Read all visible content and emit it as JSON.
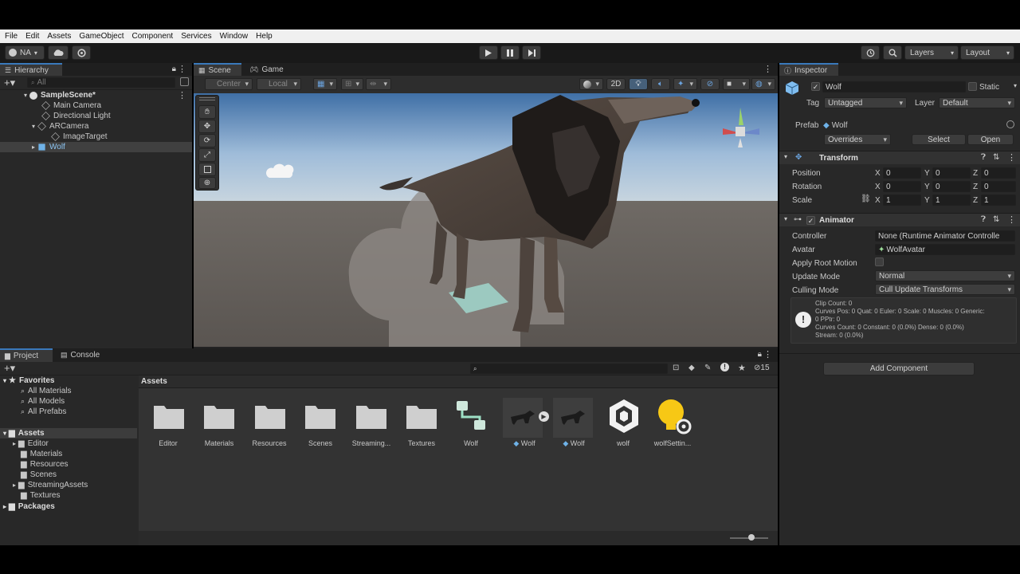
{
  "menu": [
    "File",
    "Edit",
    "Assets",
    "GameObject",
    "Component",
    "Services",
    "Window",
    "Help"
  ],
  "toolbar": {
    "account": "NA",
    "layers": "Layers",
    "layout": "Layout"
  },
  "hierarchy": {
    "tab": "Hierarchy",
    "search_placeholder": "All",
    "items": [
      {
        "label": "SampleScene*",
        "depth": 0,
        "bold": true
      },
      {
        "label": "Main Camera",
        "depth": 1
      },
      {
        "label": "Directional Light",
        "depth": 1
      },
      {
        "label": "ARCamera",
        "depth": 1
      },
      {
        "label": "ImageTarget",
        "depth": 2
      },
      {
        "label": "Wolf",
        "depth": 1,
        "selected": true
      }
    ]
  },
  "scene": {
    "tabs": [
      "Scene",
      "Game"
    ],
    "pivot": "Center",
    "space": "Local",
    "mode_2d": "2D"
  },
  "project": {
    "tabs": [
      "Project",
      "Console"
    ],
    "hidden_count": "15",
    "favorites_label": "Favorites",
    "favorites": [
      "All Materials",
      "All Models",
      "All Prefabs"
    ],
    "assets_root": "Assets",
    "asset_folders": [
      "Editor",
      "Materials",
      "Resources",
      "Scenes",
      "StreamingAssets",
      "Textures"
    ],
    "packages": "Packages",
    "breadcrumb": "Assets",
    "grid": [
      {
        "label": "Editor",
        "kind": "folder"
      },
      {
        "label": "Materials",
        "kind": "folder"
      },
      {
        "label": "Resources",
        "kind": "folder"
      },
      {
        "label": "Scenes",
        "kind": "folder"
      },
      {
        "label": "Streaming...",
        "kind": "folder"
      },
      {
        "label": "Textures",
        "kind": "folder"
      },
      {
        "label": "Wolf",
        "kind": "animator"
      },
      {
        "label": "Wolf",
        "kind": "model"
      },
      {
        "label": "Wolf",
        "kind": "prefab"
      },
      {
        "label": "wolf",
        "kind": "unity"
      },
      {
        "label": "wolfSettin...",
        "kind": "settings"
      }
    ]
  },
  "inspector": {
    "tab": "Inspector",
    "name": "Wolf",
    "static_label": "Static",
    "tag_label": "Tag",
    "tag_value": "Untagged",
    "layer_label": "Layer",
    "layer_value": "Default",
    "prefab_label": "Prefab",
    "prefab_value": "Wolf",
    "overrides": "Overrides",
    "select": "Select",
    "open": "Open",
    "transform": {
      "title": "Transform",
      "position_label": "Position",
      "rotation_label": "Rotation",
      "scale_label": "Scale",
      "position": [
        "0",
        "0",
        "0"
      ],
      "rotation": [
        "0",
        "0",
        "0"
      ],
      "scale": [
        "1",
        "1",
        "1"
      ]
    },
    "animator": {
      "title": "Animator",
      "controller_label": "Controller",
      "controller_value": "None (Runtime Animator Controlle",
      "avatar_label": "Avatar",
      "avatar_value": "WolfAvatar",
      "root_motion_label": "Apply Root Motion",
      "update_mode_label": "Update Mode",
      "update_mode_value": "Normal",
      "culling_mode_label": "Culling Mode",
      "culling_mode_value": "Cull Update Transforms",
      "info": [
        "Clip Count: 0",
        "Curves Pos: 0 Quat: 0 Euler: 0 Scale: 0 Muscles: 0 Generic:",
        "0 PPtr: 0",
        "Curves Count: 0 Constant: 0 (0.0%) Dense: 0 (0.0%)",
        "Stream: 0 (0.0%)"
      ]
    },
    "add_component": "Add Component"
  },
  "colors": {
    "accent": "#3a79bb",
    "panel": "#282828",
    "header": "#1f1f1f",
    "selection": "#2c5d87"
  }
}
